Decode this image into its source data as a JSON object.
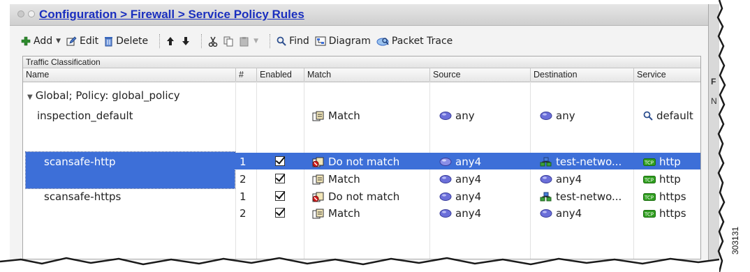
{
  "breadcrumb": "Configuration > Firewall > Service Policy Rules",
  "toolbar": {
    "add": "Add",
    "edit": "Edit",
    "delete": "Delete",
    "find": "Find",
    "diagram": "Diagram",
    "packet_trace": "Packet Trace"
  },
  "table": {
    "group_header": "Traffic Classification",
    "columns": [
      "Name",
      "#",
      "Enabled",
      "Match",
      "Source",
      "Destination",
      "Service"
    ],
    "group_row": "Global; Policy: global_policy",
    "rows": [
      {
        "name": "inspection_default",
        "num": "",
        "enabled": false,
        "match": "Match",
        "source": "any",
        "destination": "any",
        "service": "default"
      },
      {
        "name": "scansafe-http",
        "num": "1",
        "enabled": true,
        "match": "Do not match",
        "source": "any4",
        "destination": "test-netwo...",
        "service": "http",
        "selected": true
      },
      {
        "name": "",
        "num": "2",
        "enabled": true,
        "match": "Match",
        "source": "any4",
        "destination": "any4",
        "service": "http"
      },
      {
        "name": "scansafe-https",
        "num": "1",
        "enabled": true,
        "match": "Do not match",
        "source": "any4",
        "destination": "test-netwo...",
        "service": "https"
      },
      {
        "name": "",
        "num": "2",
        "enabled": true,
        "match": "Match",
        "source": "any4",
        "destination": "any4",
        "service": "https"
      }
    ]
  },
  "side_panel": {
    "label_top": "F",
    "label_mid": "N"
  },
  "figure_id": "303131",
  "colors": {
    "selection": "#3d6fd8",
    "breadcrumb": "#1a2fbf",
    "tcp_badge": "#2f9e1f"
  }
}
